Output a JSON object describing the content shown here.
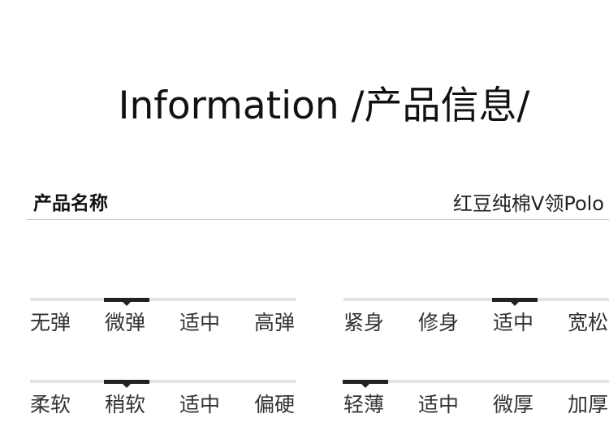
{
  "header": {
    "title": "Information /产品信息/"
  },
  "product": {
    "name_label": "产品名称",
    "name_value": "红豆纯棉V领Polo"
  },
  "scales": [
    {
      "id": "elasticity",
      "options": [
        "无弹",
        "微弹",
        "适中",
        "高弹"
      ],
      "selected_index": 1
    },
    {
      "id": "fit",
      "options": [
        "紧身",
        "修身",
        "适中",
        "宽松"
      ],
      "selected_index": 2
    },
    {
      "id": "softness",
      "options": [
        "柔软",
        "稍软",
        "适中",
        "偏硬"
      ],
      "selected_index": 1
    },
    {
      "id": "thickness",
      "options": [
        "轻薄",
        "适中",
        "微厚",
        "加厚"
      ],
      "selected_index": 0
    }
  ],
  "colors": {
    "indicator": "#222222",
    "track": "#e3e3e3",
    "divider": "#cccccc"
  }
}
